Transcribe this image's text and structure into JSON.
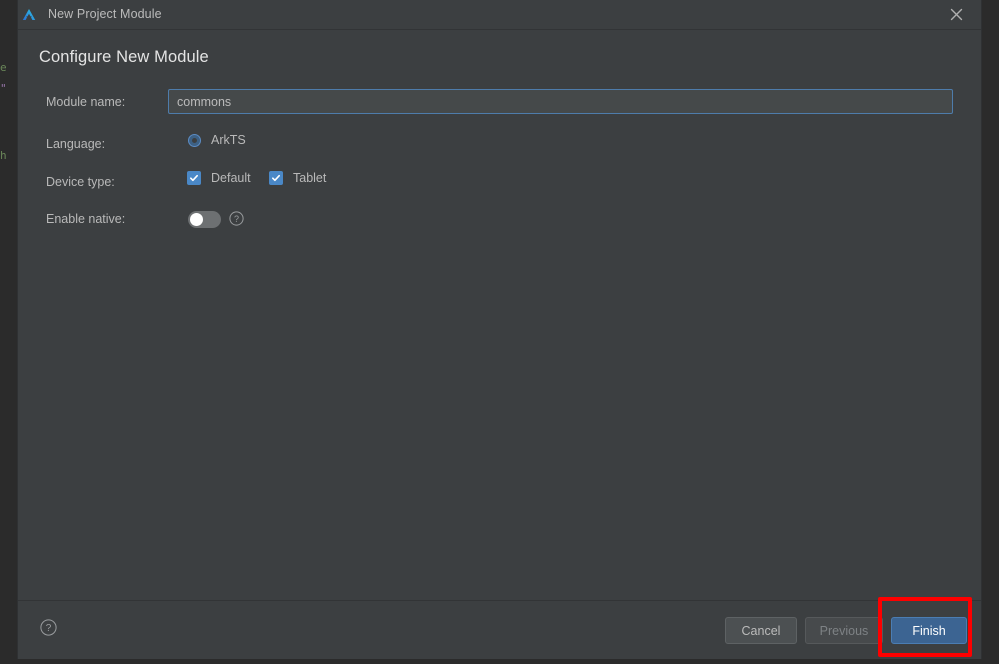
{
  "backdrop": {
    "code_fragments": [
      "e",
      "\"",
      "h"
    ]
  },
  "titlebar": {
    "app_icon": "harmony-logo-icon",
    "title": "New Project Module",
    "close_icon": "close-icon"
  },
  "content": {
    "heading": "Configure New Module",
    "fields": {
      "module_name": {
        "label": "Module name:",
        "value": "commons",
        "placeholder": ""
      },
      "language": {
        "label": "Language:",
        "options": [
          {
            "label": "ArkTS",
            "selected": true
          }
        ]
      },
      "device_type": {
        "label": "Device type:",
        "options": [
          {
            "label": "Default",
            "checked": true
          },
          {
            "label": "Tablet",
            "checked": true
          }
        ]
      },
      "enable_native": {
        "label": "Enable native:",
        "state": "off",
        "help_icon": "help-circle-icon"
      }
    }
  },
  "footer": {
    "help_icon": "help-circle-icon",
    "buttons": {
      "cancel": "Cancel",
      "previous": "Previous",
      "finish": "Finish"
    }
  },
  "annotation": {
    "target": "finish-button",
    "color": "#fe0000"
  },
  "colors": {
    "dialog_bg": "#3c3f41",
    "backdrop_bg": "#2b2b2b",
    "accent_blue": "#4a88c7",
    "primary_button": "#3c6492",
    "input_border": "#4e7cab",
    "text": "#b9b9b9",
    "heading_text": "#e4e4e4",
    "annotation_red": "#fe0000"
  }
}
